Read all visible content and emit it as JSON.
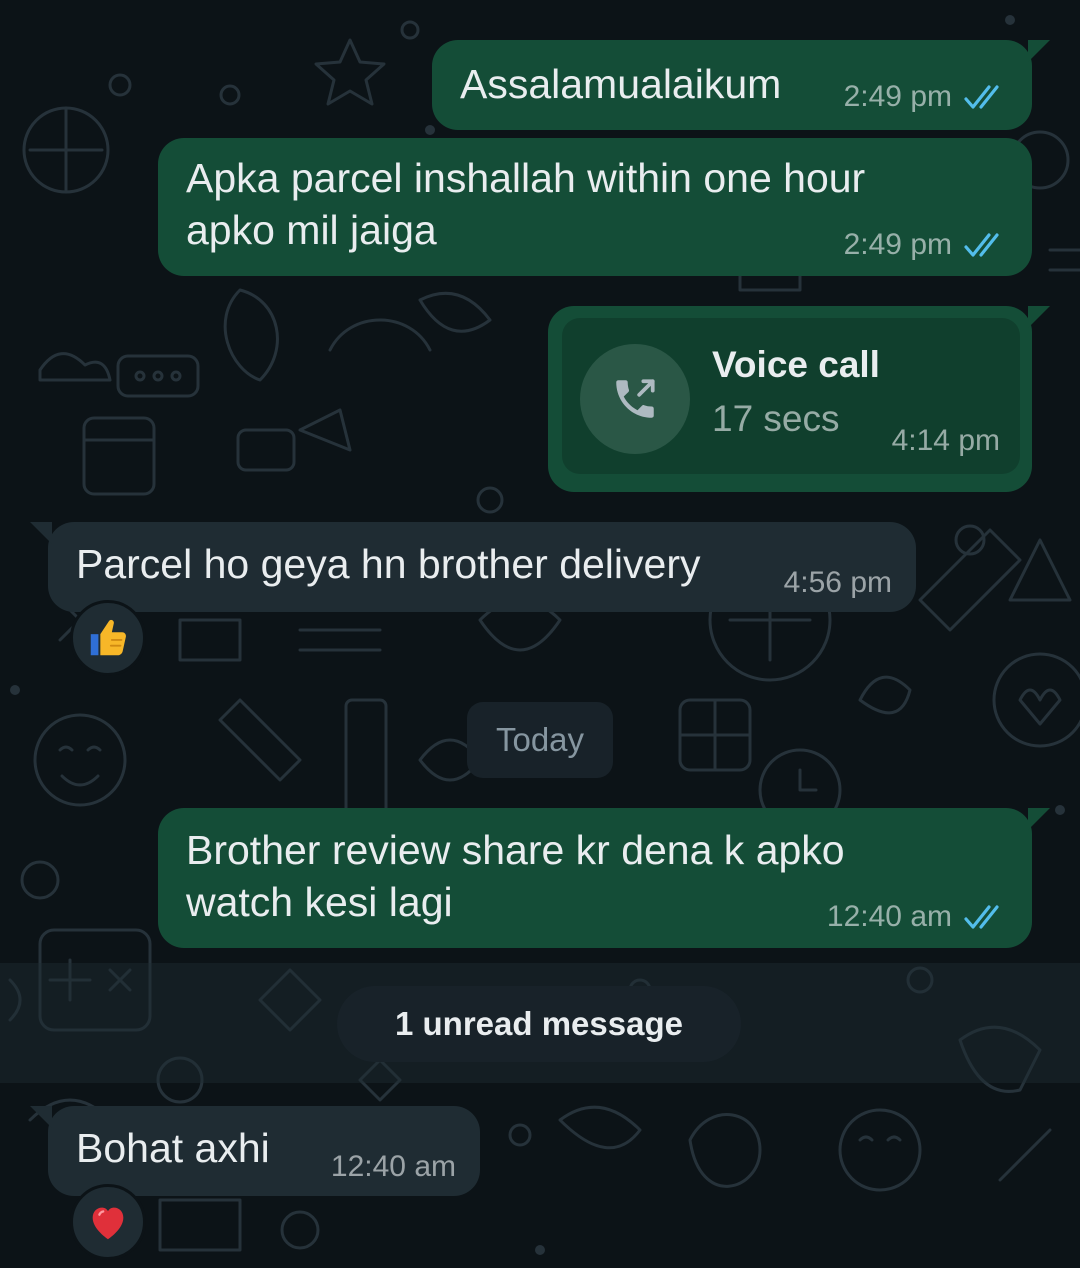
{
  "colors": {
    "background": "#0c1317",
    "outgoing_bubble": "#144d37",
    "incoming_bubble": "#1f2c33",
    "read_ticks": "#53bdeb"
  },
  "messages": [
    {
      "direction": "outgoing",
      "text": "Assalamualaikum",
      "time": "2:49 pm",
      "status_icon": "double-check-read-icon"
    },
    {
      "direction": "outgoing",
      "text": "Apka parcel inshallah within one hour\napko mil jaiga",
      "time": "2:49 pm",
      "status_icon": "double-check-read-icon"
    },
    {
      "direction": "outgoing",
      "type": "call",
      "call_icon": "outgoing-call-icon",
      "call_title": "Voice call",
      "call_duration": "17 secs",
      "time": "4:14 pm"
    },
    {
      "direction": "incoming",
      "text": "Parcel ho geya hn brother delivery",
      "time": "4:56 pm",
      "reaction": "👍",
      "reaction_icon": "thumbs-up-icon"
    },
    {
      "direction": "outgoing",
      "text": "Brother review share kr dena k apko\nwatch kesi lagi",
      "time": "12:40 am",
      "status_icon": "double-check-read-icon"
    },
    {
      "direction": "incoming",
      "text": "Bohat axhi",
      "time": "12:40 am",
      "reaction": "❤️",
      "reaction_icon": "red-heart-icon"
    }
  ],
  "date_separator": "Today",
  "unread_banner": "1 unread message"
}
